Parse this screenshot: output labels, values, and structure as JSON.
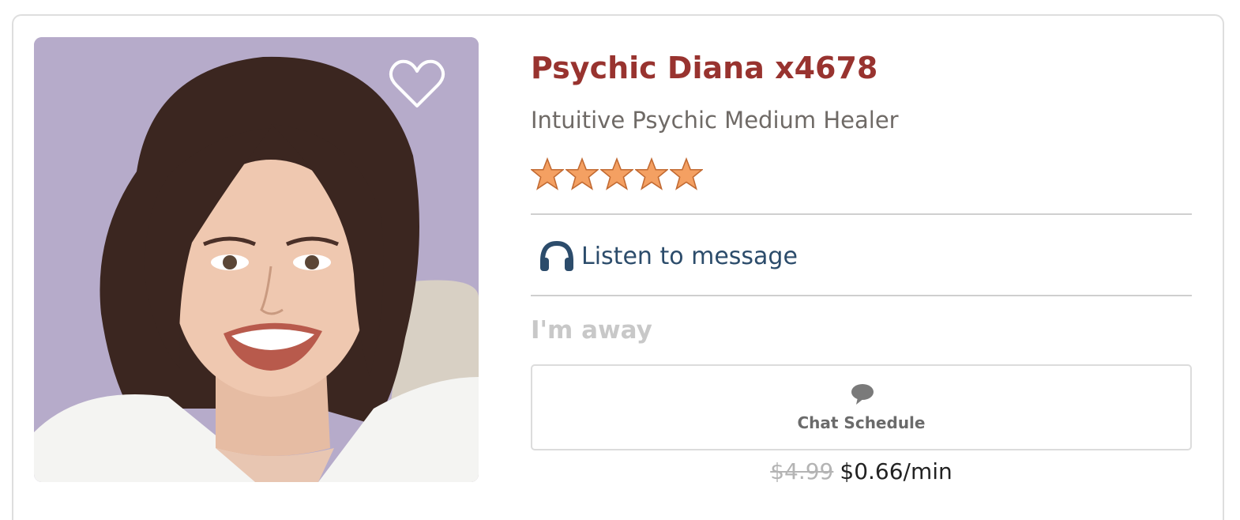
{
  "advisor": {
    "name": "Psychic Diana x4678",
    "subtitle": "Intuitive Psychic Medium Healer",
    "rating": 5,
    "rating_max": 5,
    "photo_icon": "advisor-portrait",
    "favorite_icon": "heart-outline-icon"
  },
  "audio": {
    "icon": "headphones-icon",
    "label": "Listen to message"
  },
  "status": {
    "label": "I'm away"
  },
  "schedule": {
    "icon": "chat-bubble-icon",
    "label": "Chat Schedule"
  },
  "price": {
    "old": "$4.99",
    "new": "$0.66/min"
  },
  "colors": {
    "name": "#98332f",
    "link": "#2c4c6b",
    "away": "#c8c8c8",
    "star": "#f4a062",
    "border": "#dedede"
  }
}
